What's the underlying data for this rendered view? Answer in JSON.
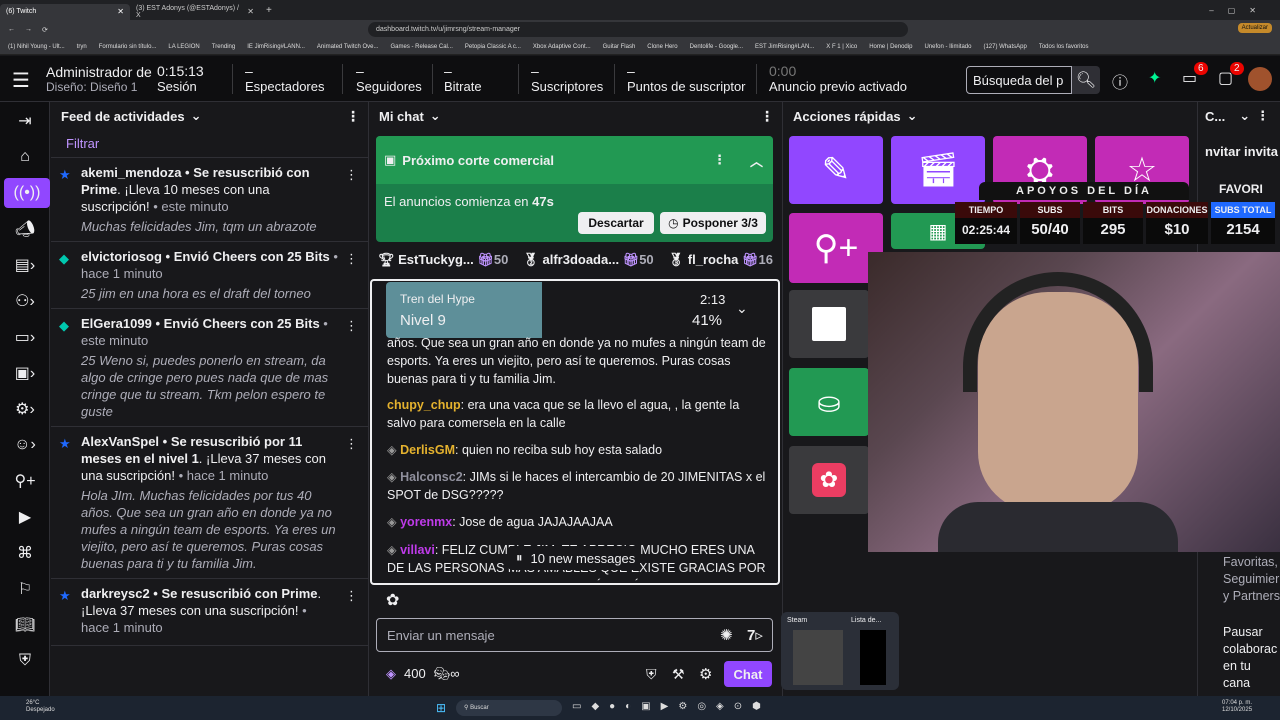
{
  "browser": {
    "tabs": [
      {
        "label": "(6) Twitch"
      },
      {
        "label": "(3) EST Adonys (@ESTAdonys) / X"
      }
    ],
    "url": "dashboard.twitch.tv/u/jimrsng/stream-manager",
    "update_label": "Actualizar",
    "bookmarks": [
      "(1) Nihil Young - Ult...",
      "tryn",
      "Formulario sin título...",
      "LA LEGION",
      "Trending",
      "IE JimRising#LANN...",
      "Animated Twitch Ove...",
      "Games - Release Cal...",
      "Petopia Classic A c...",
      "Xbox Adaptive Cont...",
      "Guitar Flash",
      "Clone Hero",
      "Dentolife - Google...",
      "EST JimRising#LAN...",
      "X F 1 | Xico",
      "Home | Denodip",
      "Unefon - Ilimitado",
      "(127) WhatsApp",
      "Todos los favoritos"
    ]
  },
  "header": {
    "title": "Administrador de s",
    "subtitle": "Diseño: Diseño 1",
    "stats": [
      {
        "value": "0:15:13",
        "label": "Sesión"
      },
      {
        "value": "–",
        "label": "Espectadores"
      },
      {
        "value": "–",
        "label": "Seguidores"
      },
      {
        "value": "–",
        "label": "Bitrate"
      },
      {
        "value": "–",
        "label": "Suscriptores"
      },
      {
        "value": "–",
        "label": "Puntos de suscriptor"
      },
      {
        "value": "0:00",
        "label": "Anuncio previo activado"
      }
    ],
    "search_placeholder": "Búsqueda del p",
    "badges": {
      "inbox": "6",
      "whispers": "2"
    }
  },
  "feed": {
    "title": "Feed de actividades",
    "filter": "Filtrar",
    "items": [
      {
        "user": "akemi_mendoza",
        "action": " • Se resuscribió con ",
        "bold2": "Prime",
        "rest": ". ¡Lleva 10 meses con una suscripción!",
        "time": " • este minuto",
        "msg": "Muchas felicidades Jim, tqm un abrazote"
      },
      {
        "user": "elvictoriosog",
        "action": " • Envió Cheers con ",
        "bold2": "25 Bits",
        "rest": "",
        "time": " • hace 1 minuto",
        "msg": "25 jim en una hora es el draft del torneo"
      },
      {
        "user": "ElGera1099",
        "action": " • Envió Cheers con ",
        "bold2": "25 Bits",
        "rest": "",
        "time": " • este minuto",
        "msg": "25 Weno si, puedes ponerlo en stream, da algo de cringe pero pues nada que de mas cringe que tu stream. Tkm pelon espero te guste"
      },
      {
        "user": "AlexVanSpel",
        "action": " • Se resuscribió por 11 meses en el ",
        "bold2": "nivel 1",
        "rest": ". ¡Lleva 37 meses con una suscripción!",
        "time": " • hace 1 minuto",
        "msg": "Hola JIm. Muchas felicidades por tus 40 años. Que sea un gran año en donde ya no mufes a ningún team de esports. Ya eres un viejito, pero así te queremos. Puras cosas buenas para ti y tu familia Jim."
      },
      {
        "user": "darkreysc2",
        "action": " • Se resuscribió con ",
        "bold2": "Prime",
        "rest": ". ¡Lleva 37 meses con una suscripción!",
        "time": " • hace 1 minuto",
        "msg": ""
      }
    ]
  },
  "chat": {
    "title": "Mi chat",
    "ad_title": "Próximo corte comercial",
    "ad_text": "El anuncios comienza en ",
    "ad_time": "47s",
    "dismiss": "Descartar",
    "postpone": "Posponer 3/3",
    "leaders": [
      {
        "name": "EstTuckyg...",
        "count": "50"
      },
      {
        "name": "alfr3doada...",
        "count": "50"
      },
      {
        "name": "fl_rocha",
        "count": "16"
      }
    ],
    "hype": {
      "label": "Tren del Hype",
      "level": "Nivel 9",
      "time": "2:13",
      "pct": "41%"
    },
    "messages": [
      {
        "user": "",
        "text": "años. Que sea un gran año en donde ya no mufes a ningún team de esports. Ya eres un viejito, pero así te queremos. Puras cosas buenas para ti y tu familia Jim."
      },
      {
        "user": "chupy_chup",
        "text": ": era una vaca que se la llevo el agua, , la gente la salvo para comersela en la calle"
      },
      {
        "user": "DerlisGM",
        "text": ": quien no reciba sub hoy esta salado"
      },
      {
        "user": "Halconsc2",
        "text": ": JIMs si le haces el intercambio de 20 JIMENITAS x el SPOT de DSG?????"
      },
      {
        "user": "yorenmx",
        "text": ": Jose de agua JAJAJAAJAA"
      },
      {
        "user": "villavi",
        "text": ": FELIZ CUMPLE JIM, TE APRECIO MUCHO ERES UNA DE LAS PERSONAS MÁS AMABLES QUE EXISTE GRACIAS POR AYUDARME EN MIS MOMENTOS MÁS DIFÍCILES"
      }
    ],
    "new_messages": "10 new messages",
    "input_placeholder": "Enviar un mensaje",
    "points": "400",
    "send": "Chat"
  },
  "quick": {
    "title": "Acciones rápidas",
    "colors": [
      "#9147ff",
      "#9147ff",
      "#c22bb6",
      "#c22bb6",
      "#c22bb6",
      "#229953",
      "#3a3a3d",
      "#229953",
      "#3a3a3d"
    ]
  },
  "right": {
    "title": "C...",
    "invite": "nvitar invita",
    "favs": "FAVORI",
    "favs2": "FAVORI",
    "links": "Favoritas, Seguimier y Partners",
    "pause": "Pausar colaborac en tu cana"
  },
  "overlay": {
    "title": "APOYOS DEL DÍA",
    "cols": [
      {
        "label": "TIEMPO",
        "value": "02:25:44"
      },
      {
        "label": "SUBS",
        "value": "50/40"
      },
      {
        "label": "BITS",
        "value": "295"
      },
      {
        "label": "DONACIONES",
        "value": "$10"
      },
      {
        "label": "SUBS TOTAL",
        "value": "2154"
      }
    ]
  },
  "taskbar": {
    "weather": "26°C",
    "weather_sub": "Despejado",
    "search": "Buscar",
    "time": "07:04 p. m.",
    "date": "12/10/2025",
    "preview": [
      "Steam",
      "Lista de..."
    ]
  }
}
